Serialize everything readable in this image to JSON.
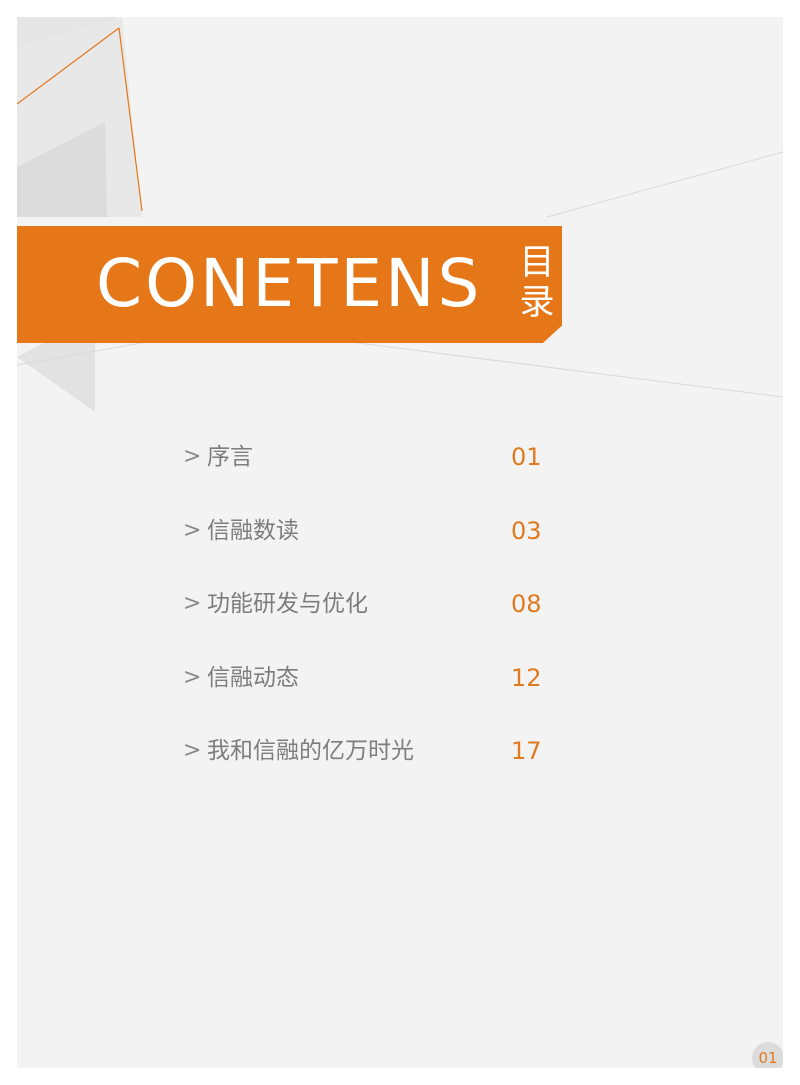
{
  "banner": {
    "title": "CONETENS",
    "subtitle": "目录",
    "color": "#e57719"
  },
  "toc": {
    "marker": ">",
    "items": [
      {
        "label": "序言",
        "page": "01"
      },
      {
        "label": "信融数读",
        "page": "03"
      },
      {
        "label": "功能研发与优化",
        "page": "08"
      },
      {
        "label": "信融动态",
        "page": "12"
      },
      {
        "label": "我和信融的亿万时光",
        "page": "17"
      }
    ]
  },
  "footer": {
    "page_number": "01"
  },
  "colors": {
    "accent": "#e57719",
    "page_background": "#f3f3f3",
    "text": "#7d7d7d"
  }
}
